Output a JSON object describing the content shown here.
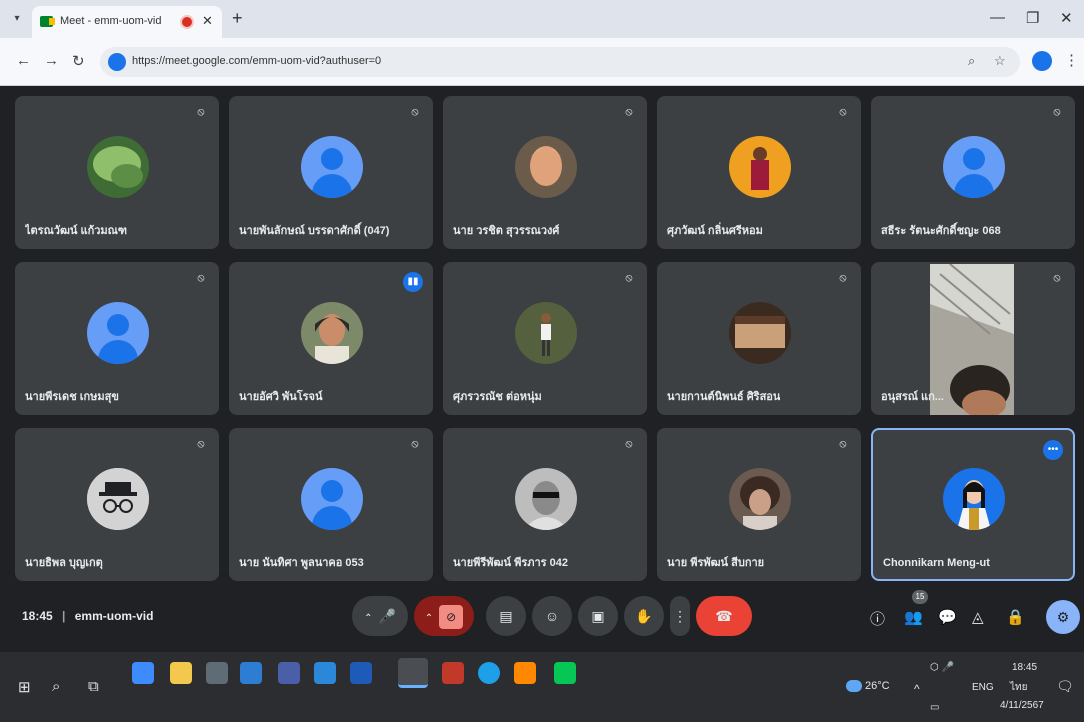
{
  "browser": {
    "menu_icon": "▾",
    "tab_title": "Meet - emm-uom-vid",
    "tab_close": "✕",
    "new_tab": "+",
    "minimize": "—",
    "maximize": "❐",
    "close": "✕",
    "back": "←",
    "forward": "→",
    "reload": "↻",
    "url": "https://meet.google.com/emm-uom-vid?authuser=0",
    "zoom_icon": "⌕",
    "star_icon": "☆",
    "menu": "⋮"
  },
  "participants": [
    {
      "name": "ไตรณวัฒน์ แก้วมณฑ",
      "avatar": "photo-leaf",
      "mic": "muted"
    },
    {
      "name": "นายพันลักษณ์ บรรดาศักดิ์ (047)",
      "avatar": "default",
      "mic": "muted"
    },
    {
      "name": "นาย วรชิต สุวรรณวงศ์",
      "avatar": "photo-man",
      "mic": "muted"
    },
    {
      "name": "ศุภวัฒน์ กลิ่นศรีหอม",
      "avatar": "photo-orange",
      "mic": "muted"
    },
    {
      "name": "สธีระ รัตนะศักดิ์ชญะ 068",
      "avatar": "default",
      "mic": "muted"
    },
    {
      "name": "นายพีรเดช เกษมสุข",
      "avatar": "default",
      "mic": "muted"
    },
    {
      "name": "นายอัศวิ พันโรจน์",
      "avatar": "photo-woman",
      "mic": "speaking"
    },
    {
      "name": "ศุภรวรณัช ต่อหนุ่ม",
      "avatar": "photo-outdoor",
      "mic": "muted"
    },
    {
      "name": "นายกานต์นิพนธ์ ศิริสอน",
      "avatar": "photo-bed",
      "mic": "muted"
    },
    {
      "name": "อนุสรณ์ แก...",
      "avatar": "video",
      "mic": "muted"
    },
    {
      "name": "นายธิพล บุญเกตุ",
      "avatar": "anonymous",
      "mic": "muted"
    },
    {
      "name": "นาย นันทิศา พูลนาคอ 053",
      "avatar": "default",
      "mic": "muted"
    },
    {
      "name": "นายพีรีพัฒน์ พีรภาร 042",
      "avatar": "photo-sunglasses",
      "mic": "muted"
    },
    {
      "name": "นาย พีรพัฒน์ สีบกาย",
      "avatar": "photo-curly",
      "mic": "muted"
    },
    {
      "name": "Chonnikarn Meng-ut",
      "avatar": "photo-you",
      "mic": "more"
    }
  ],
  "meetbar": {
    "time": "18:45",
    "separator": "|",
    "meeting_code": "emm-uom-vid",
    "participant_count": "15",
    "mic_icon": "🎤",
    "cam_icon": "⊘",
    "cc_icon": "▤",
    "emoji_icon": "☺",
    "present_icon": "▣",
    "hand_icon": "✋",
    "more_icon": "⋮",
    "hangup_icon": "☎",
    "info_icon": "ⓘ",
    "people_icon": "👥",
    "chat_icon": "💬",
    "activities_icon": "◬",
    "lock_icon": "🔒",
    "host_icon": "⚙"
  },
  "taskbar": {
    "start": "⊞",
    "search": "⌕",
    "taskview": "⧉",
    "weather": "26°C",
    "chevron": "^",
    "lang": "ENG",
    "lang2": "ไทย",
    "clock_time": "18:45",
    "clock_date": "4/11/2567",
    "notif": "🗨"
  },
  "colors": {
    "meet_bg": "#202124",
    "tile_bg": "#3c4043",
    "hangup": "#ea4335",
    "accent": "#8ab4f8"
  }
}
